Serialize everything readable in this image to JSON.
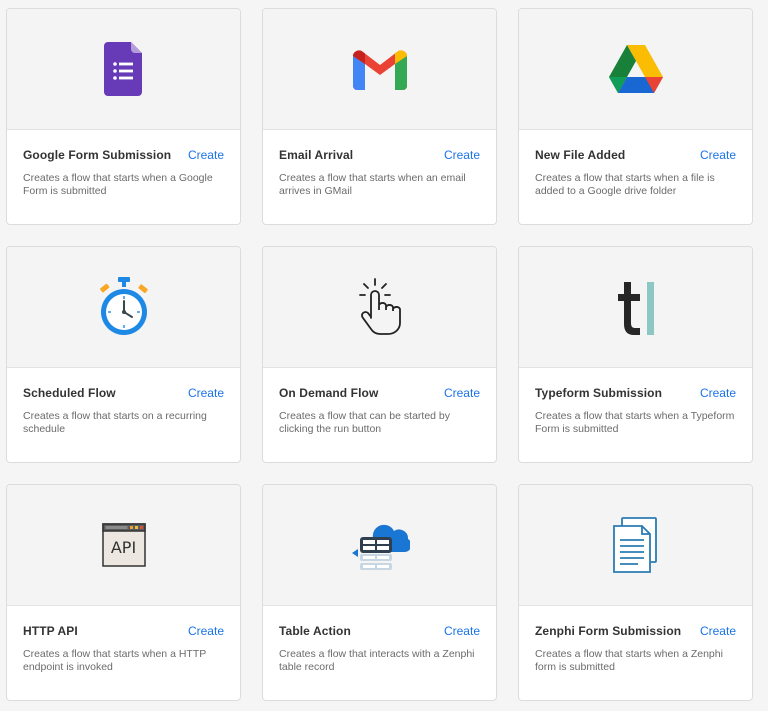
{
  "cards": [
    {
      "title": "Google Form Submission",
      "action": "Create",
      "description": "Creates a flow that starts when a Google Form is submitted",
      "icon": "google-forms-icon"
    },
    {
      "title": "Email Arrival",
      "action": "Create",
      "description": "Creates a flow that starts when an email arrives in GMail",
      "icon": "gmail-icon"
    },
    {
      "title": "New File Added",
      "action": "Create",
      "description": "Creates a flow that starts when a file is added to a Google drive folder",
      "icon": "google-drive-icon"
    },
    {
      "title": "Scheduled Flow",
      "action": "Create",
      "description": "Creates a flow that starts on a recurring schedule",
      "icon": "stopwatch-icon"
    },
    {
      "title": "On Demand Flow",
      "action": "Create",
      "description": "Creates a flow that can be started by clicking the run button",
      "icon": "tap-hand-icon"
    },
    {
      "title": "Typeform Submission",
      "action": "Create",
      "description": "Creates a flow that starts when a Typeform Form is submitted",
      "icon": "typeform-icon"
    },
    {
      "title": "HTTP API",
      "action": "Create",
      "description": "Creates a flow that starts when a HTTP endpoint is invoked",
      "icon": "api-window-icon",
      "icon_text": "API"
    },
    {
      "title": "Table Action",
      "action": "Create",
      "description": "Creates a flow that interacts with a Zenphi table record",
      "icon": "cloud-table-icon"
    },
    {
      "title": "Zenphi Form Submission",
      "action": "Create",
      "description": "Creates a flow that starts when a Zenphi form is submitted",
      "icon": "documents-icon"
    }
  ],
  "colors": {
    "accent": "#1a73e8",
    "forms_purple": "#673ab7",
    "gmail_red": "#ea4335",
    "drive_green": "#188038",
    "drive_yellow": "#fbbc04",
    "drive_blue": "#1967d2",
    "stopwatch_blue": "#1e88e5",
    "typeform_teal": "#8cc7c3",
    "documents_blue": "#2b7cb3"
  }
}
